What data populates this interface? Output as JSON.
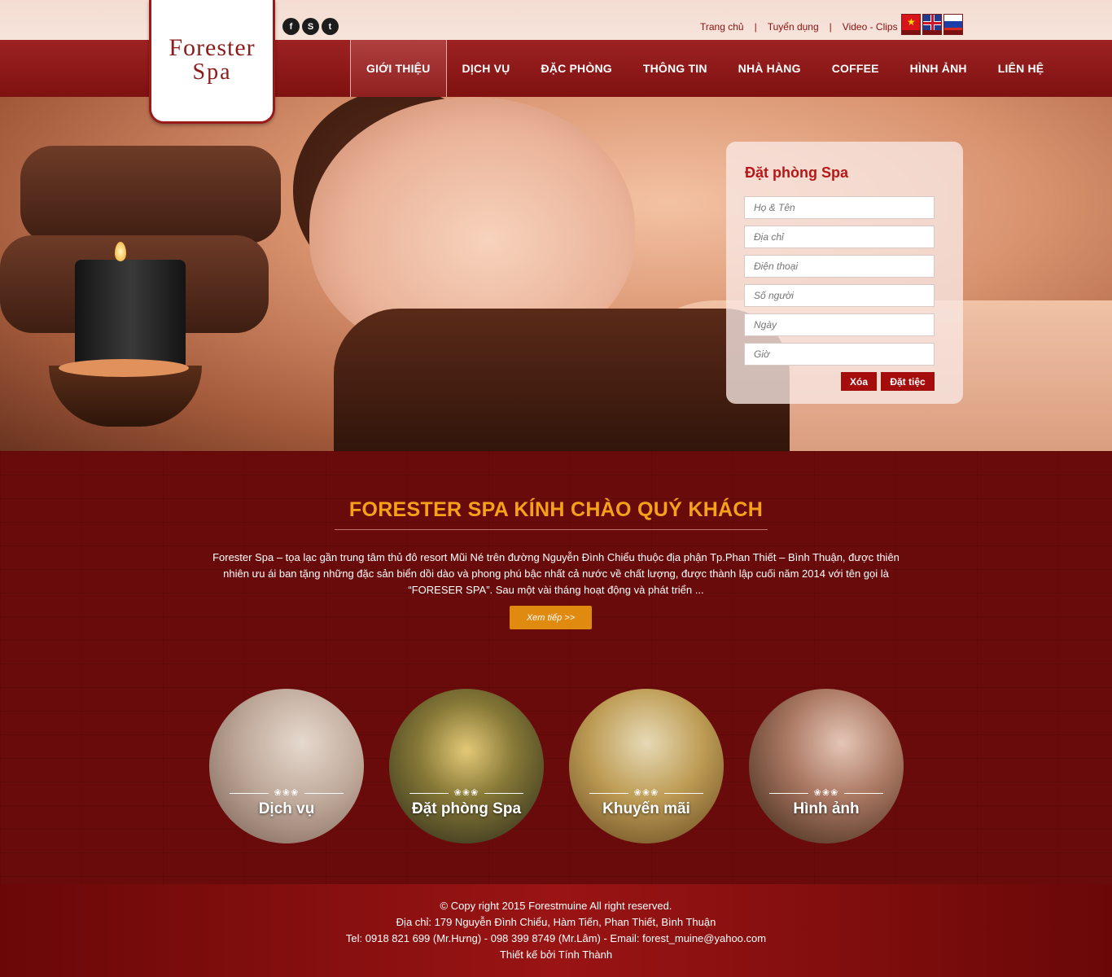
{
  "logo": {
    "line1": "Forester",
    "line2": "Spa"
  },
  "social": [
    {
      "icon": "facebook-icon",
      "glyph": "f"
    },
    {
      "icon": "skype-icon",
      "glyph": "S"
    },
    {
      "icon": "twitter-icon",
      "glyph": "t"
    }
  ],
  "top_links": [
    "Trang chủ",
    "Tuyển dụng",
    "Video - Clips"
  ],
  "languages": [
    "vietnam-flag-icon",
    "english-flag-icon",
    "russia-flag-icon"
  ],
  "nav": [
    "GIỚI THIỆU",
    "DỊCH VỤ",
    "ĐẶC PHÒNG",
    "THÔNG TIN",
    "NHÀ HÀNG",
    "COFFEE",
    "HÌNH ẢNH",
    "LIÊN HỆ"
  ],
  "nav_active_index": 0,
  "booking": {
    "title": "Đặt phòng Spa",
    "fields": [
      {
        "placeholder": "Họ & Tên",
        "value": ""
      },
      {
        "placeholder": "Địa chỉ",
        "value": ""
      },
      {
        "placeholder": "Điện thoại",
        "value": ""
      },
      {
        "placeholder": "Số người",
        "value": ""
      },
      {
        "placeholder": "Ngày",
        "value": ""
      },
      {
        "placeholder": "Giờ",
        "value": ""
      }
    ],
    "clear_label": "Xóa",
    "submit_label": "Đặt tiệc"
  },
  "welcome": {
    "title": "FORESTER SPA KÍNH CHÀO QUÝ KHÁCH",
    "text": "Forester Spa – tọa lạc gần trung tâm thủ đô resort Mũi Né trên đường Nguyễn Đình Chiểu thuộc địa phận Tp.Phan Thiết – Bình Thuận, được thiên nhiên ưu ái ban tặng những đặc sản biển dồi dào và phong phú bậc nhất cả nước về chất lượng, được thành lập cuối năm 2014 với tên gọi là “FORESER SPA”. Sau một vài tháng hoạt động và phát triển ...",
    "more_label": "Xem tiếp >>"
  },
  "features": [
    {
      "label": "Dịch vụ",
      "stars": "❀❀❀"
    },
    {
      "label": "Đặt phòng Spa",
      "stars": "❀❀❀"
    },
    {
      "label": "Khuyến mãi",
      "stars": "❀❀❀"
    },
    {
      "label": "Hình ảnh",
      "stars": "❀❀❀"
    }
  ],
  "footer": {
    "copyright": "© Copy right 2015 Forestmuine All right reserved.",
    "address": "Địa chỉ: 179 Nguyễn Đình Chiểu, Hàm Tiến, Phan Thiết, Bình Thuận",
    "contact": "Tel: 0918 821 699 (Mr.Hưng) - 098 399 8749 (Mr.Lâm)  -  Email: forest_muine@yahoo.com",
    "designer": "Thiết kế bởi Tính Thành"
  }
}
